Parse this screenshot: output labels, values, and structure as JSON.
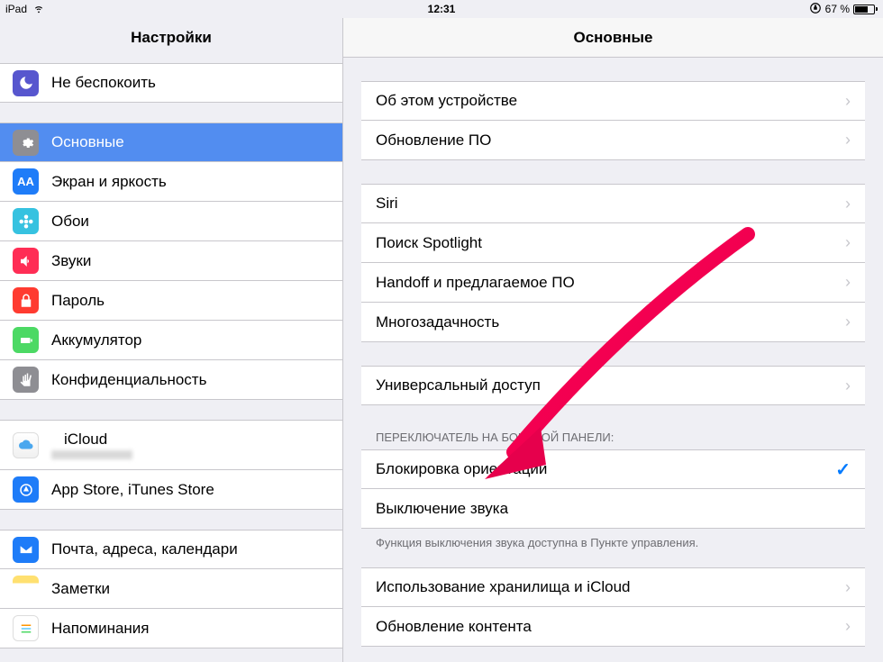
{
  "status": {
    "device": "iPad",
    "time": "12:31",
    "battery_pct": "67 %"
  },
  "sidebar": {
    "title": "Настройки",
    "items": [
      {
        "label": "Не беспокоить",
        "icon": "moon",
        "color": "#5756ce"
      },
      {
        "label": "Основные",
        "icon": "gear",
        "color": "#8e8e93",
        "selected": true
      },
      {
        "label": "Экран и яркость",
        "icon": "aa",
        "color": "#1e7cf8"
      },
      {
        "label": "Обои",
        "icon": "flower",
        "color": "#36c2e0"
      },
      {
        "label": "Звуки",
        "icon": "speaker",
        "color": "#ff2d55"
      },
      {
        "label": "Пароль",
        "icon": "lock",
        "color": "#ff3b30"
      },
      {
        "label": "Аккумулятор",
        "icon": "battery",
        "color": "#4cd964"
      },
      {
        "label": "Конфиденциальность",
        "icon": "hand",
        "color": "#8e8e93"
      }
    ],
    "group2": [
      {
        "label": "iCloud",
        "icon": "cloud",
        "color": "#ffffff"
      },
      {
        "label": "App Store, iTunes Store",
        "icon": "appstore",
        "color": "#1e7cf8"
      }
    ],
    "group3": [
      {
        "label": "Почта, адреса, календари",
        "icon": "mail",
        "color": "#1e7cf8"
      },
      {
        "label": "Заметки",
        "icon": "notes",
        "color": "#ffcc00"
      },
      {
        "label": "Напоминания",
        "icon": "reminders",
        "color": "#ffffff"
      }
    ]
  },
  "content": {
    "title": "Основные",
    "g1": [
      {
        "label": "Об этом устройстве"
      },
      {
        "label": "Обновление ПО"
      }
    ],
    "g2": [
      {
        "label": "Siri"
      },
      {
        "label": "Поиск Spotlight"
      },
      {
        "label": "Handoff и предлагаемое ПО"
      },
      {
        "label": "Многозадачность"
      }
    ],
    "g3": [
      {
        "label": "Универсальный доступ"
      }
    ],
    "side_switch_header": "Переключатель на боковой панели:",
    "g4": [
      {
        "label": "Блокировка ориентации",
        "checked": true
      },
      {
        "label": "Выключение звука"
      }
    ],
    "side_switch_footer": "Функция выключения звука доступна в Пункте управления.",
    "g5": [
      {
        "label": "Использование хранилища и iCloud"
      },
      {
        "label": "Обновление контента"
      }
    ]
  }
}
